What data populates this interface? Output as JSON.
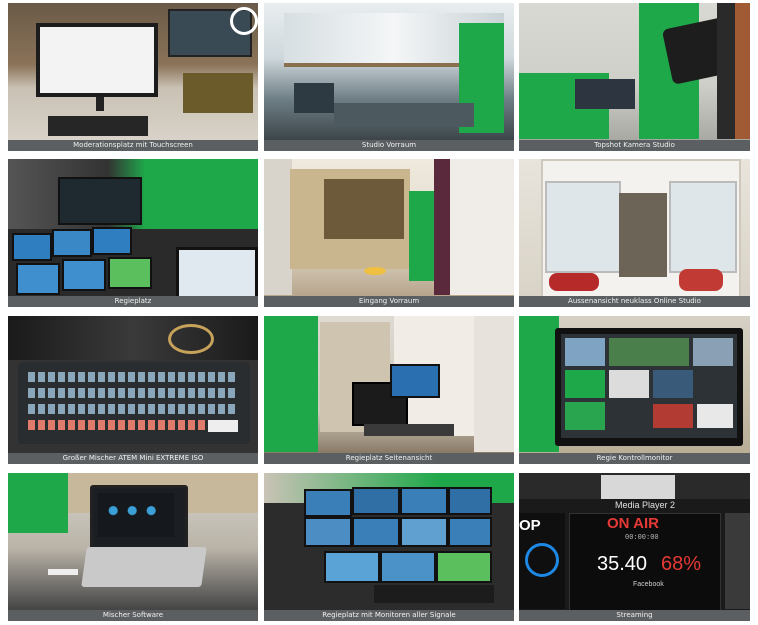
{
  "gallery": {
    "tiles": [
      {
        "caption": "Moderationsplatz mit Touchscreen"
      },
      {
        "caption": "Studio Vorraum"
      },
      {
        "caption": "Topshot Kamera Studio"
      },
      {
        "caption": "Regieplatz"
      },
      {
        "caption": "Eingang Vorraum"
      },
      {
        "caption": "Aussenansicht neuklass Online Studio"
      },
      {
        "caption": "Großer Mischer ATEM Mini EXTREME ISO"
      },
      {
        "caption": "Regieplatz Seitenansicht"
      },
      {
        "caption": "Regie Kontrollmonitor"
      },
      {
        "caption": "Mischer Software"
      },
      {
        "caption": "Regieplatz mit Monitoren aller Signale"
      },
      {
        "caption": "Streaming"
      }
    ]
  },
  "streaming_panel": {
    "title": "Media Player 2",
    "status": "ON AIR",
    "timer": "00:00:00",
    "value_left": "35.40",
    "value_right": "68%",
    "platform": "Facebook",
    "edge_text": "OP"
  },
  "colors": {
    "caption_bar": "#5b5f61",
    "chroma_green": "#1fa84a",
    "on_air_red": "#e53935"
  }
}
